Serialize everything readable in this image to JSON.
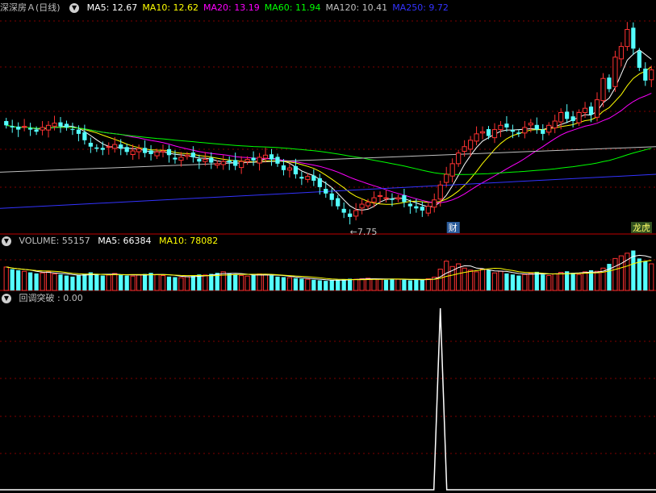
{
  "main": {
    "stock_name": "深深房Ａ",
    "period": "(日线)",
    "indicators": [
      {
        "label": "MA5: 12.67",
        "color": "#ffffff"
      },
      {
        "label": "MA10: 12.62",
        "color": "#ffff00"
      },
      {
        "label": "MA20: 13.19",
        "color": "#ff00ff"
      },
      {
        "label": "MA60: 11.94",
        "color": "#00ff00"
      },
      {
        "label": "MA120: 10.41",
        "color": "#c0c0c0"
      },
      {
        "label": "MA250: 9.72",
        "color": "#3333ff"
      }
    ],
    "min_label": "←7.75",
    "cai_badge": "财",
    "dragon_badge": "龙虎"
  },
  "volume": {
    "label": "VOLUME: 55157",
    "ma5": "MA5: 66384",
    "ma10": "MA10: 78082"
  },
  "signal": {
    "label": "回调突破 : 0.00"
  },
  "colors": {
    "up": "#ff3232",
    "down": "#54ffff",
    "grid": "#800000"
  },
  "chart_data": {
    "type": "candlestick",
    "ylim": [
      7.2,
      17.5
    ],
    "closes": [
      12.3,
      12.2,
      12.1,
      12.25,
      12.1,
      12.0,
      12.2,
      12.3,
      12.4,
      12.25,
      12.2,
      12.1,
      11.9,
      11.6,
      11.3,
      11.2,
      11.15,
      11.3,
      11.4,
      11.2,
      11.05,
      11.1,
      11.2,
      11.0,
      10.95,
      11.05,
      11.1,
      10.9,
      10.7,
      10.8,
      10.9,
      10.8,
      10.6,
      10.7,
      10.55,
      10.5,
      10.6,
      10.55,
      10.4,
      10.6,
      10.7,
      10.65,
      10.8,
      10.9,
      10.7,
      10.5,
      10.2,
      10.3,
      10.0,
      9.8,
      9.9,
      9.7,
      9.4,
      9.1,
      8.8,
      8.5,
      8.2,
      8.0,
      8.3,
      8.6,
      8.7,
      8.9,
      9.0,
      8.9,
      8.8,
      8.9,
      8.7,
      8.5,
      8.4,
      8.3,
      8.5,
      8.8,
      9.5,
      10.0,
      10.5,
      11.0,
      11.3,
      11.6,
      11.9,
      12.0,
      11.8,
      12.1,
      12.3,
      12.2,
      12.0,
      11.9,
      12.2,
      12.4,
      12.1,
      11.9,
      12.3,
      12.5,
      12.9,
      12.6,
      12.5,
      12.9,
      13.1,
      12.8,
      13.5,
      14.5,
      14.0,
      15.5,
      16.0,
      16.8,
      15.9,
      15.0,
      14.4,
      14.9
    ],
    "volumes": [
      44,
      40,
      38,
      36,
      34,
      32,
      33,
      35,
      31,
      30,
      28,
      26,
      29,
      31,
      34,
      30,
      28,
      29,
      32,
      30,
      28,
      27,
      29,
      31,
      33,
      30,
      28,
      26,
      25,
      24,
      26,
      28,
      30,
      29,
      31,
      33,
      35,
      32,
      30,
      28,
      27,
      29,
      31,
      30,
      28,
      26,
      25,
      24,
      23,
      22,
      21,
      20,
      19,
      18,
      19,
      20,
      21,
      22,
      21,
      22,
      23,
      22,
      21,
      20,
      22,
      21,
      20,
      19,
      20,
      21,
      22,
      25,
      40,
      55,
      45,
      50,
      42,
      38,
      35,
      40,
      38,
      33,
      36,
      32,
      30,
      28,
      30,
      32,
      35,
      30,
      28,
      31,
      34,
      36,
      33,
      30,
      35,
      38,
      36,
      42,
      50,
      60,
      65,
      70,
      75,
      60,
      55,
      50
    ],
    "signal": {
      "spike_index": 72,
      "value": 1.0
    }
  }
}
